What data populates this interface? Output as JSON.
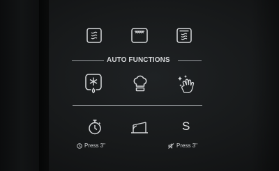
{
  "panel": {
    "section_title": "AUTO FUNCTIONS",
    "top_row_icons": [
      "oven-mode-steam-icon",
      "oven-mode-top-heat-icon",
      "oven-mode-steam-grill-icon"
    ],
    "auto_function_icons": [
      "defrost-icon",
      "chef-hat-icon",
      "cleaning-icon"
    ],
    "bottom_controls": {
      "timer": {
        "icon": "stopwatch-icon",
        "hint": "Press 3\""
      },
      "level": {
        "icon": "tilt-level-icon"
      },
      "sound": {
        "letter": "S",
        "hint": "Press 3\""
      }
    }
  },
  "colors": {
    "background": "#17191a",
    "icon_stroke": "#d8dadc",
    "text": "#d6d8da"
  }
}
